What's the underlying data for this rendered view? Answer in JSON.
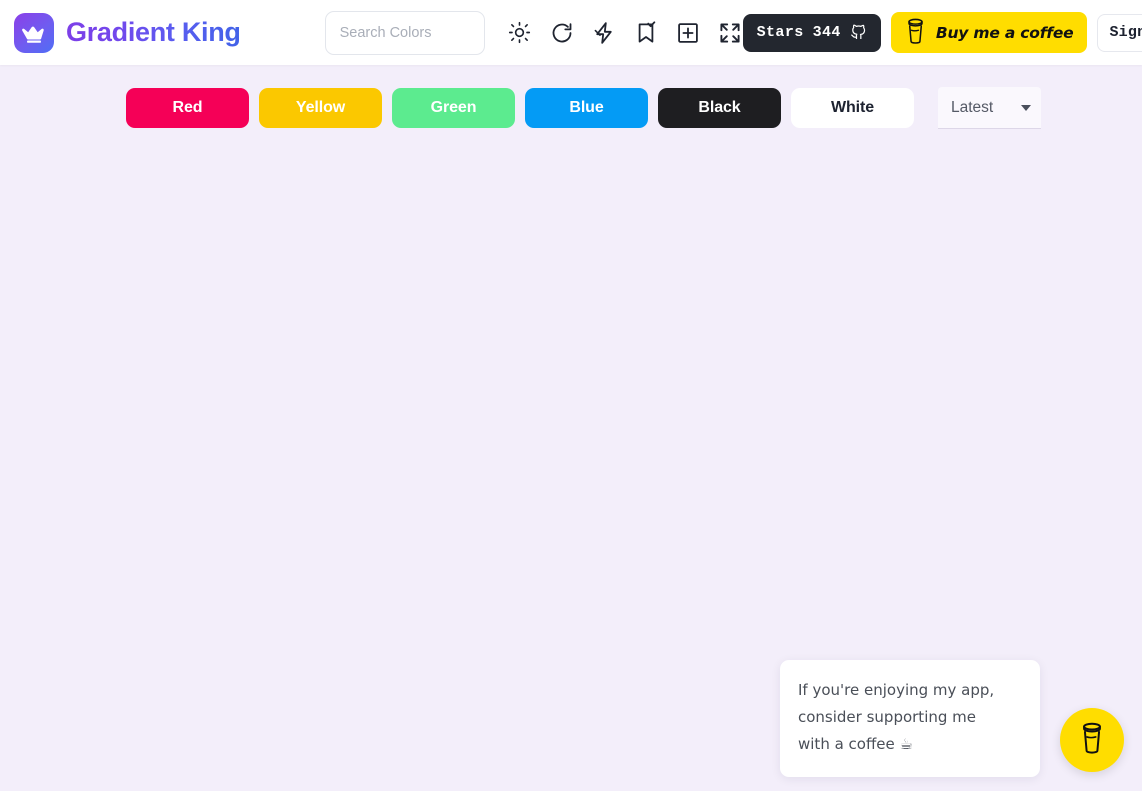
{
  "app": {
    "name": "Gradient King",
    "logo_icon": "crown-icon",
    "background_color": "#f3eefa",
    "brand_gradient_from": "#7d3fe8",
    "brand_gradient_to": "#4263e8"
  },
  "header": {
    "search": {
      "placeholder": "Search Colors",
      "value": ""
    },
    "icons": [
      {
        "name": "sun-icon",
        "label": "Theme"
      },
      {
        "name": "refresh-icon",
        "label": "Refresh"
      },
      {
        "name": "lightning-icon",
        "label": "Generate"
      },
      {
        "name": "bookmark-check-icon",
        "label": "Saved"
      },
      {
        "name": "plus-square-icon",
        "label": "Create"
      },
      {
        "name": "expand-icon",
        "label": "Fullscreen"
      }
    ],
    "stars": {
      "label": "Stars",
      "count": "344",
      "icon": "github-icon",
      "background_color": "#23272f"
    },
    "coffee": {
      "label": "Buy me a coffee",
      "icon": "coffee-cup-icon",
      "background_color": "#ffdd00"
    },
    "signin": {
      "label": "Sign In",
      "icon": "google-icon"
    }
  },
  "filters": {
    "chips": [
      {
        "label": "Red",
        "color": "#f50057",
        "text_color": "#ffffff"
      },
      {
        "label": "Yellow",
        "color": "#fbc800",
        "text_color": "#ffffff"
      },
      {
        "label": "Green",
        "color": "#5ceb8f",
        "text_color": "#ffffff"
      },
      {
        "label": "Blue",
        "color": "#049bf5",
        "text_color": "#ffffff"
      },
      {
        "label": "Black",
        "color": "#1e1e21",
        "text_color": "#ffffff"
      },
      {
        "label": "White",
        "color": "#ffffff",
        "text_color": "#1d2230"
      }
    ],
    "sort": {
      "selected": "Latest",
      "icon": "chevron-down-icon"
    }
  },
  "tooltip": {
    "line1": "If you're enjoying my app,",
    "line2": "consider supporting me",
    "line3": "with a coffee ☕"
  },
  "fab": {
    "icon": "coffee-cup-icon",
    "background_color": "#ffdd00"
  }
}
